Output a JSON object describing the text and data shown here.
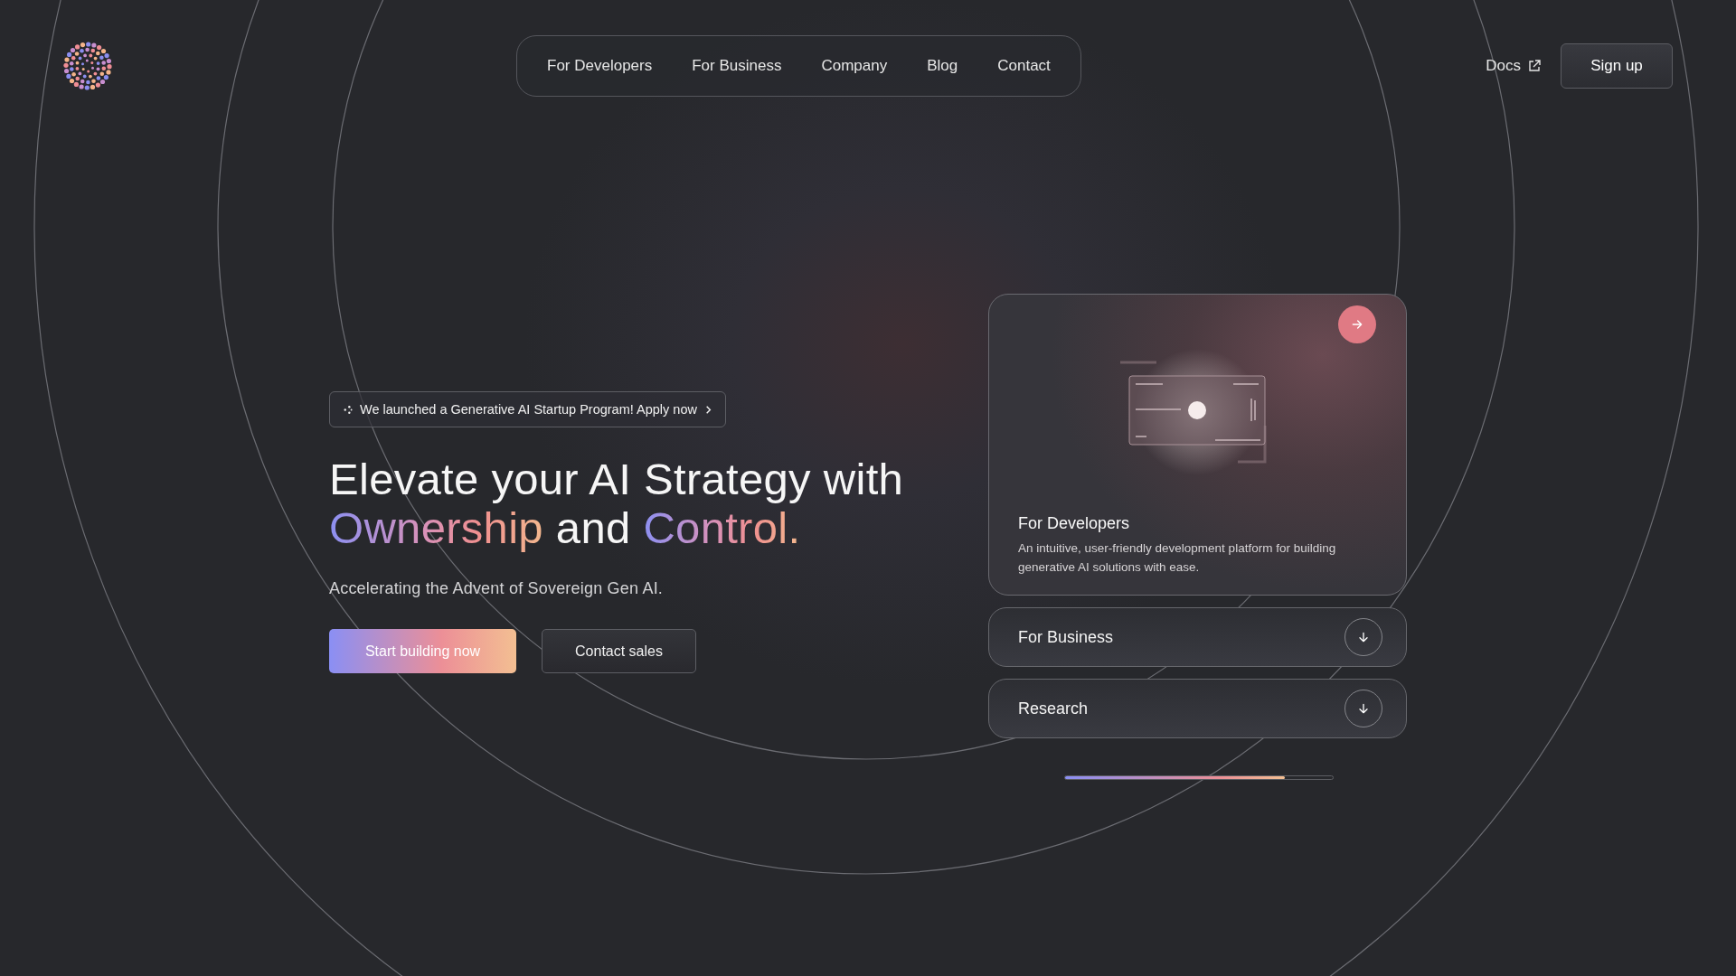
{
  "header": {
    "nav": [
      "For Developers",
      "For Business",
      "Company",
      "Blog",
      "Contact"
    ],
    "docs_link": "Docs",
    "signup_button": "Sign up"
  },
  "hero": {
    "announcement": "We launched a Generative AI Startup Program! Apply now",
    "headline": [
      {
        "text": "Elevate your AI Strategy with",
        "highlight": false
      },
      {
        "text": "Ownership",
        "highlight": true
      },
      {
        "text": " and ",
        "highlight": false
      },
      {
        "text": "Control.",
        "highlight": true
      }
    ],
    "subtitle": "Accelerating the Advent of Sovereign Gen AI.",
    "buttons": [
      {
        "label": "Start building now",
        "kind": "primary"
      },
      {
        "label": "Contact sales",
        "kind": "secondary"
      }
    ]
  },
  "features": [
    {
      "title": "For Developers",
      "description": "An intuitive, user-friendly development platform for building generative AI solutions with ease.",
      "expanded": true
    },
    {
      "title": "For Business",
      "expanded": false
    },
    {
      "title": "Research",
      "expanded": false
    }
  ],
  "progress": {
    "level": 0.82
  }
}
